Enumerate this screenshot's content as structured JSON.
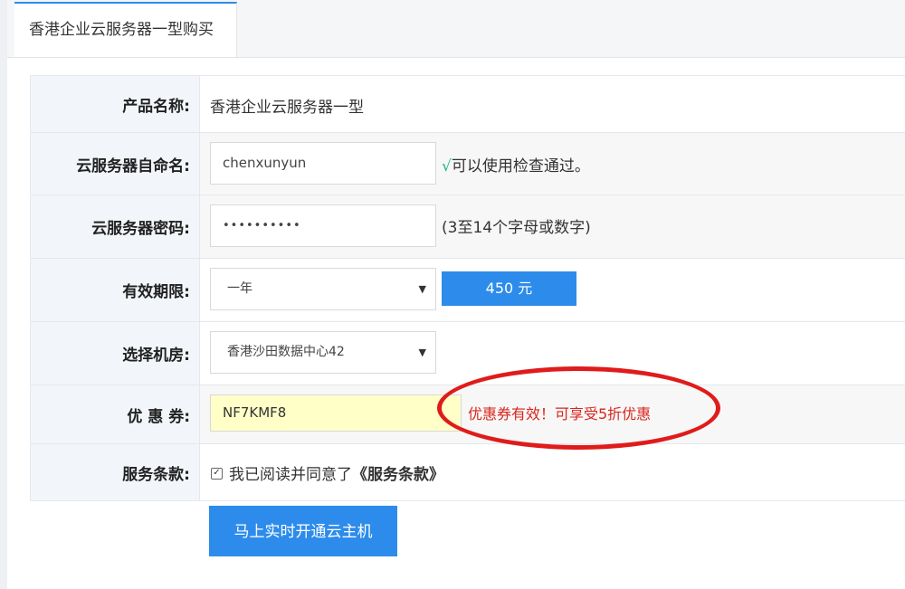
{
  "tab": {
    "title": "香港企业云服务器一型购买"
  },
  "form": {
    "product": {
      "label": "产品名称:",
      "value": "香港企业云服务器一型"
    },
    "server_name": {
      "label": "云服务器自命名:",
      "value": "chenxunyun",
      "check_mark": "√",
      "status": "可以使用检查通过。"
    },
    "password": {
      "label": "云服务器密码:",
      "value": "••••••••••",
      "hint": "(3至14个字母或数字)"
    },
    "period": {
      "label": "有效期限:",
      "selected": "一年",
      "price": "450 元"
    },
    "datacenter": {
      "label": "选择机房:",
      "selected": "香港沙田数据中心42"
    },
    "coupon": {
      "label": "优 惠 券:",
      "value": "NF7KMF8",
      "message": "优惠券有效！可享受5折优惠"
    },
    "terms": {
      "label": "服务条款:",
      "text": "我已阅读并同意了",
      "link": "《服务条款》",
      "checked": true
    }
  },
  "submit_label": "马上实时开通云主机",
  "colors": {
    "accent": "#2d8ceb",
    "highlight_ring": "#e01b1b",
    "success": "#27b48a",
    "coupon_bg": "#ffffc7"
  }
}
